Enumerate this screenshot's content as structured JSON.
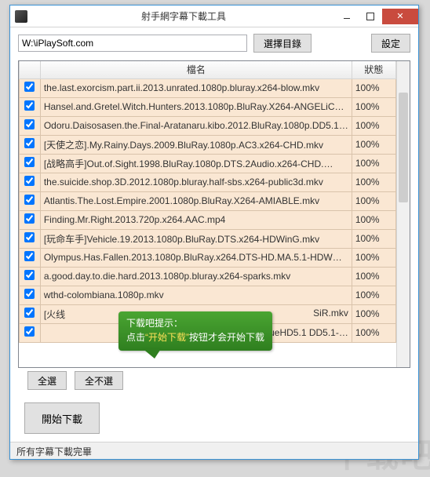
{
  "window": {
    "title": "射手網字幕下載工具"
  },
  "path": {
    "value": "W:\\iPlaySoft.com"
  },
  "buttons": {
    "browse": "選擇目錄",
    "settings": "設定",
    "selectAll": "全選",
    "selectNone": "全不選",
    "start": "開始下載"
  },
  "columns": {
    "name": "檔名",
    "status": "狀態"
  },
  "rows": [
    {
      "checked": true,
      "name": "the.last.exorcism.part.ii.2013.unrated.1080p.bluray.x264-blow.mkv",
      "status": "100%"
    },
    {
      "checked": true,
      "name": "Hansel.and.Gretel.Witch.Hunters.2013.1080p.BluRay.X264-ANGELiC…",
      "status": "100%"
    },
    {
      "checked": true,
      "name": "Odoru.Daisosasen.the.Final-Aratanaru.kibo.2012.BluRay.1080p.DD5.1…",
      "status": "100%"
    },
    {
      "checked": true,
      "name": "[天使之恋].My.Rainy.Days.2009.BluRay.1080p.AC3.x264-CHD.mkv",
      "status": "100%"
    },
    {
      "checked": true,
      "name": "[战略高手]Out.of.Sight.1998.BluRay.1080p.DTS.2Audio.x264-CHD.…",
      "status": "100%"
    },
    {
      "checked": true,
      "name": "the.suicide.shop.3D.2012.1080p.bluray.half-sbs.x264-public3d.mkv",
      "status": "100%"
    },
    {
      "checked": true,
      "name": "Atlantis.The.Lost.Empire.2001.1080p.BluRay.X264-AMIABLE.mkv",
      "status": "100%"
    },
    {
      "checked": true,
      "name": "Finding.Mr.Right.2013.720p.x264.AAC.mp4",
      "status": "100%"
    },
    {
      "checked": true,
      "name": "[玩命车手]Vehicle.19.2013.1080p.BluRay.DTS.x264-HDWinG.mkv",
      "status": "100%"
    },
    {
      "checked": true,
      "name": "Olympus.Has.Fallen.2013.1080p.BluRay.x264.DTS-HD.MA.5.1-HDW…",
      "status": "100%"
    },
    {
      "checked": true,
      "name": "a.good.day.to.die.hard.2013.1080p.bluray.x264-sparks.mkv",
      "status": "100%"
    },
    {
      "checked": true,
      "name": "wthd-colombiana.1080p.mkv",
      "status": "100%"
    },
    {
      "checked": true,
      "name": "[火线",
      "status": "100%",
      "tail": "SiR.mkv"
    },
    {
      "checked": true,
      "name": "",
      "status": "100%",
      "tail": "ueHD5.1 DD5.1-…"
    }
  ],
  "tooltip": {
    "line1": "下载吧提示：",
    "line2a": "点击",
    "line2b": "“开始下载”",
    "line2c": "按钮才会开始下载"
  },
  "statusbar": "所有字幕下載完畢",
  "watermark": "下载吧"
}
